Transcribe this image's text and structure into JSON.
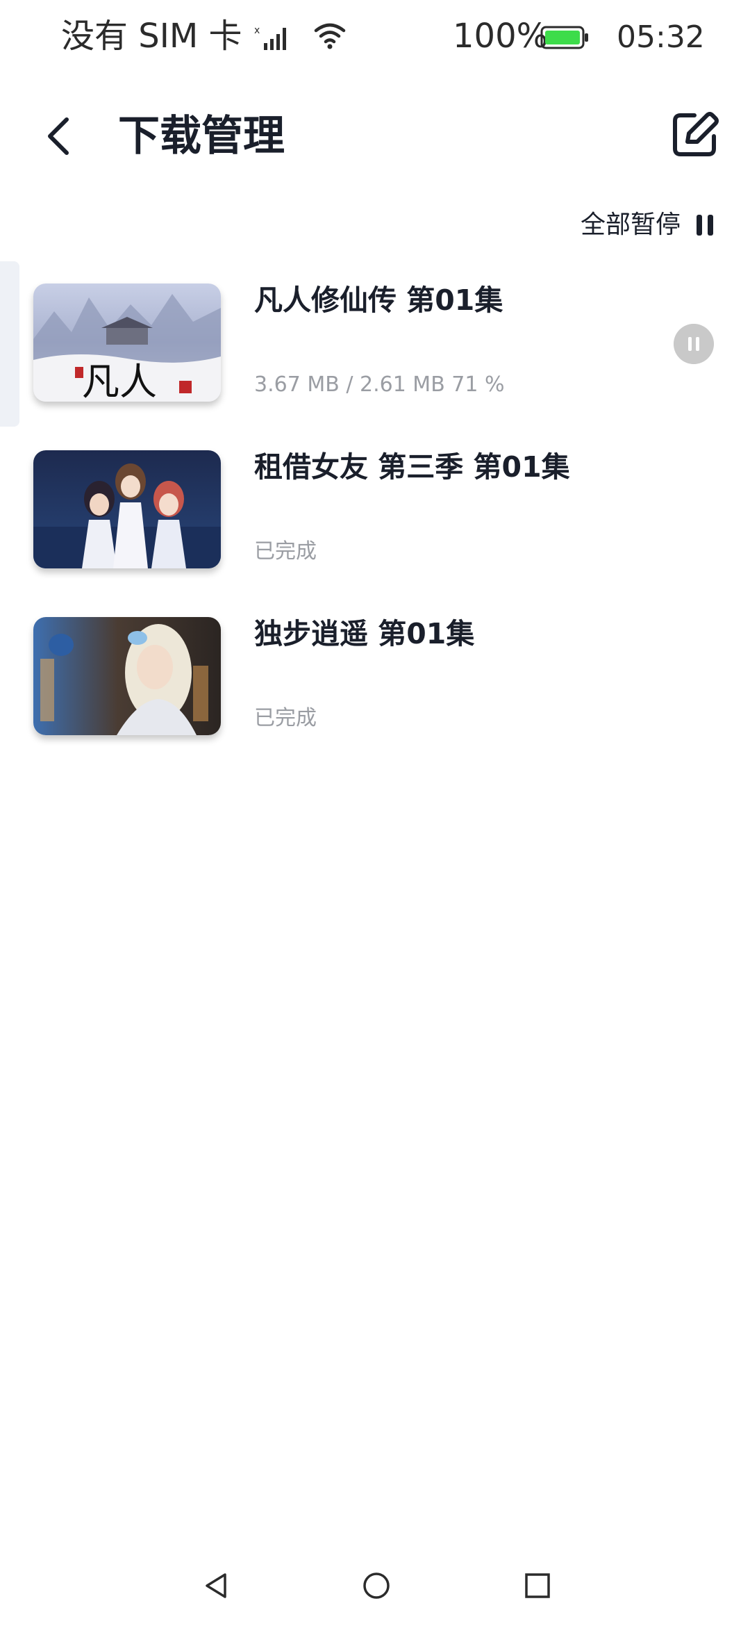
{
  "status_bar": {
    "carrier": "没有 SIM 卡",
    "battery_percent": "100%",
    "battery_level": 1.0,
    "battery_color": "#3ddc4a",
    "time": "05:32",
    "icons": [
      "signal-icon",
      "wifi-icon",
      "battery-icon"
    ]
  },
  "header": {
    "title": "下载管理",
    "back_icon": "chevron-left-icon",
    "edit_icon": "edit-icon"
  },
  "pause_all": {
    "label": "全部暂停",
    "icon": "pause-icon"
  },
  "downloads": [
    {
      "title": "凡人修仙传 第01集",
      "status": "3.67 MB / 2.61 MB 71 %",
      "state": "downloading",
      "thumbnail_text": "凡人",
      "action_icon": "pause-icon"
    },
    {
      "title": "租借女友 第三季 第01集",
      "status": "已完成",
      "state": "completed"
    },
    {
      "title": "独步逍遥 第01集",
      "status": "已完成",
      "state": "completed"
    }
  ],
  "nav_bar": {
    "icons": [
      "back-triangle-icon",
      "home-circle-icon",
      "recents-square-icon"
    ]
  },
  "colors": {
    "text_primary": "#1a1f2b",
    "text_secondary": "#9a9da3",
    "pause_circle": "#c9c9c9",
    "active_row_marker": "#eef1f6"
  }
}
